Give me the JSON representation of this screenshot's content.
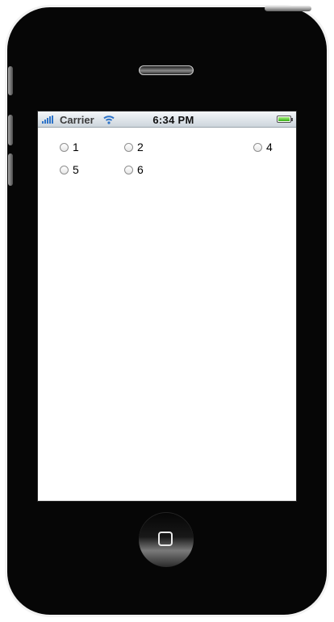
{
  "device": {
    "model_icon": "iphone-frame"
  },
  "status_bar": {
    "carrier": "Carrier",
    "time": "6:34 PM",
    "signal_icon": "signal-bars-icon",
    "wifi_icon": "wifi-icon",
    "battery_icon": "battery-icon",
    "battery_level": 1.0
  },
  "radio_group": {
    "options": [
      {
        "label": "1"
      },
      {
        "label": "2"
      },
      {
        "label": "4"
      },
      {
        "label": "5"
      },
      {
        "label": "6"
      }
    ]
  },
  "colors": {
    "status_bar": "#cdd5dc",
    "accent": "#2d73c8",
    "battery": "#34b014"
  }
}
